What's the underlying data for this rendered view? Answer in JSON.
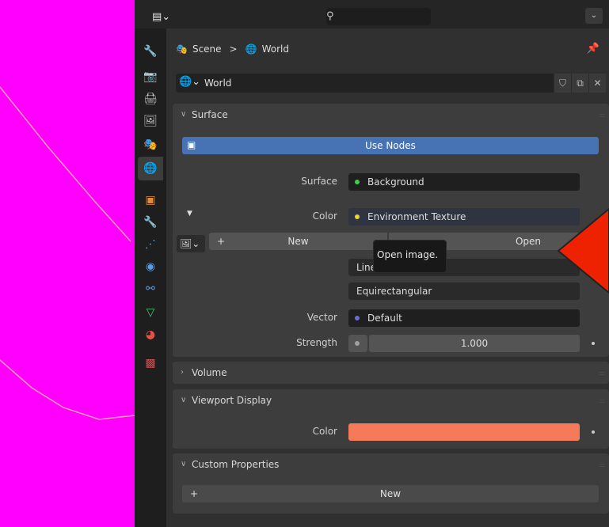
{
  "header": {
    "editor_type_icon": "properties-editor-icon",
    "search_icon": "search-icon"
  },
  "tabs": [
    {
      "icon": "tool-icon",
      "glyph": "🔧",
      "color": "#c8c8c8"
    },
    {
      "icon": "render-icon",
      "glyph": "📷",
      "color": "#c8c8c8"
    },
    {
      "icon": "output-icon",
      "glyph": "🖨",
      "color": "#c8c8c8"
    },
    {
      "icon": "view-layer-icon",
      "glyph": "🖼",
      "color": "#c8c8c8"
    },
    {
      "icon": "scene-icon",
      "glyph": "🎭",
      "color": "#c8c8c8"
    },
    {
      "icon": "world-icon",
      "glyph": "🌐",
      "color": "#e0524a"
    },
    {
      "icon": "object-icon",
      "glyph": "▣",
      "color": "#e08b3a"
    },
    {
      "icon": "modifier-icon",
      "glyph": "🔧",
      "color": "#5b9be0"
    },
    {
      "icon": "particles-icon",
      "glyph": "⋰",
      "color": "#5b9be0"
    },
    {
      "icon": "physics-icon",
      "glyph": "◉",
      "color": "#5b9be0"
    },
    {
      "icon": "constraints-icon",
      "glyph": "⚯",
      "color": "#5b9be0"
    },
    {
      "icon": "data-icon",
      "glyph": "▽",
      "color": "#44c27a"
    },
    {
      "icon": "material-icon",
      "glyph": "◕",
      "color": "#e0524a"
    },
    {
      "icon": "texture-icon",
      "glyph": "▩",
      "color": "#d05050"
    }
  ],
  "breadcrumb": {
    "scene": "Scene",
    "separator": ">",
    "world": "World"
  },
  "datablock": {
    "name": "World"
  },
  "surface_panel": {
    "title": "Surface",
    "use_nodes": "Use Nodes",
    "surface_label": "Surface",
    "surface_value": "Background",
    "surface_dot_color": "#3fcf4a",
    "color_label": "Color",
    "color_value": "Environment Texture",
    "color_dot_color": "#e8d43a",
    "new_label": "New",
    "open_label": "Open",
    "interpolation": "Linear",
    "projection": "Equirectangular",
    "vector_label": "Vector",
    "vector_value": "Default",
    "vector_dot_color": "#6b6bd8",
    "strength_label": "Strength",
    "strength_value": "1.000"
  },
  "volume_panel": {
    "title": "Volume"
  },
  "viewport_display_panel": {
    "title": "Viewport Display",
    "color_label": "Color",
    "color_swatch": "#f47a5a"
  },
  "custom_properties_panel": {
    "title": "Custom Properties",
    "new_label": "New"
  },
  "tooltip": {
    "text": "Open image."
  },
  "colors": {
    "viewport_bg": "#ff00ff",
    "accent_blue": "#4772b3",
    "annotation_arrow": "#ee2200"
  }
}
